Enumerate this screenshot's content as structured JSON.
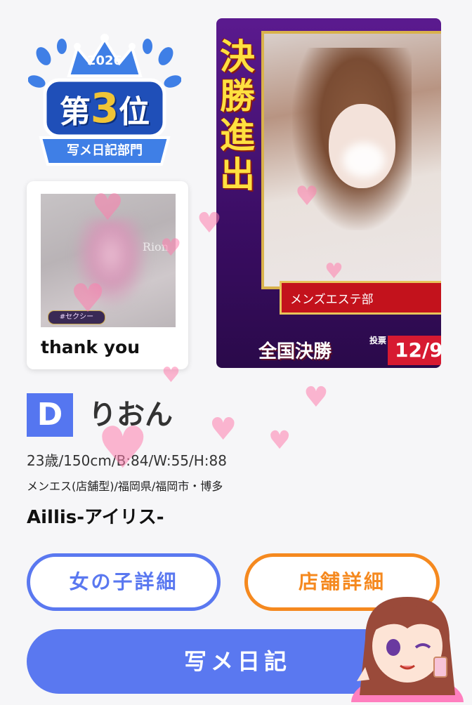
{
  "badge": {
    "year": "2026",
    "rank_prefix": "第",
    "rank_number": "3",
    "rank_suffix": "位",
    "category": "写メ日記部門",
    "colors": {
      "blue": "#3f7fe6",
      "dark_blue": "#1f4fb8",
      "gold": "#f0c437"
    }
  },
  "diary_card": {
    "tag": "#セクシー",
    "watermark": "Rion",
    "caption": "thank you"
  },
  "banner": {
    "vertical_text": "決勝進出",
    "category": "メンズエステ部",
    "final_label": "全国決勝",
    "vote_label": "投票",
    "date": "12/9"
  },
  "profile": {
    "grade": "D",
    "name": "りおん",
    "stats": "23歳/150cm/B:84/W:55/H:88",
    "area": "メンエス(店舗型)/福岡県/福岡市・博多",
    "shop": "Aillis-アイリス-"
  },
  "buttons": {
    "girl_detail": "女の子詳細",
    "shop_detail": "店舗詳細",
    "photo_diary": "写メ日記"
  },
  "icons": [
    "crown-icon",
    "heart-icon",
    "mascot-icon"
  ],
  "colors": {
    "primary": "#5a78f0",
    "orange": "#f5891f",
    "heart": "#ff7fae"
  }
}
